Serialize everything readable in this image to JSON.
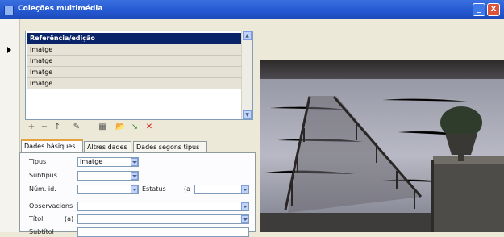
{
  "window": {
    "title": "Coleções multimédia",
    "buttons": {
      "minimize": "_",
      "close": "X"
    }
  },
  "list": {
    "items": [
      {
        "label": "Referência/edição",
        "selected": true
      },
      {
        "label": "Imatge",
        "selected": false
      },
      {
        "label": "Imatge",
        "selected": false
      },
      {
        "label": "Imatge",
        "selected": false
      },
      {
        "label": "Imatge",
        "selected": false
      }
    ]
  },
  "toolbar": {
    "add": "+",
    "remove": "−",
    "up": "↑",
    "edit": "✎",
    "grid": "▦",
    "folder": "📂",
    "arrow": "↘",
    "delete": "✕"
  },
  "tabs": [
    "Dades bàsiques",
    "Altres dades",
    "Dades segons tipus"
  ],
  "form": {
    "tipus_label": "Tipus",
    "tipus_value": "Imatge",
    "subtipus_label": "Subtipus",
    "num_label": "Núm. id.",
    "estatus_label": "Estatus",
    "estatus_prefix": "(a",
    "observacions_label": "Observacions",
    "titol_label": "Títol",
    "titol_prefix": "(a)",
    "subtitol_label": "Subtítol"
  },
  "colors": {
    "titlebar": "#2458d0",
    "selection": "#0a246a",
    "water": "#a7a8b4"
  }
}
